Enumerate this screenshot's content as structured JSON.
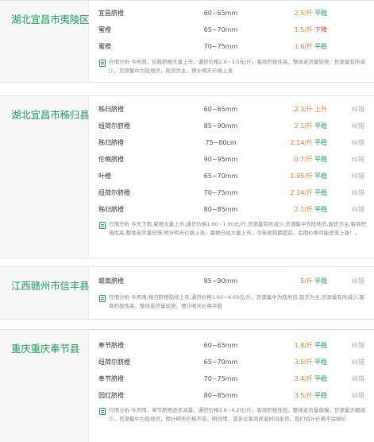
{
  "blocks": [
    {
      "region": "湖北宜昌市夷陵区",
      "rows": [
        {
          "name": "宜昌脐橙",
          "size": "60~65mm",
          "price": "2.5/斤",
          "trend": "平稳",
          "trend_type": "stable",
          "extra": ""
        },
        {
          "name": "蜜橙",
          "size": "65~70mm",
          "price": "1.5/斤",
          "trend": "下降",
          "trend_type": "down",
          "extra": ""
        },
        {
          "name": "蜜橙",
          "size": "70~75mm",
          "price": "1.6/斤",
          "trend": "平稳",
          "trend_type": "stable",
          "extra": ""
        }
      ],
      "note": "行情分析 今天阴，伦晚脐橙大量上市，通货价格2.8~3.5元/斤，客商积极性高，整体走货量较快，货源量有所减少，货源集中为陆地货，现货为主，预计明天价格上涨"
    },
    {
      "region": "湖北宜昌市秭归县",
      "rows": [
        {
          "name": "秭归脐橙",
          "size": "60~65mm",
          "price": "2.3/斤",
          "trend": "上升",
          "trend_type": "up",
          "extra": "纠错"
        },
        {
          "name": "纽荷尔脐橙",
          "size": "85~90mm",
          "price": "2.1/斤",
          "trend": "平稳",
          "trend_type": "stable",
          "extra": "纠错"
        },
        {
          "name": "秭归脐橙",
          "size": "75~80cm",
          "price": "2.14/斤",
          "trend": "平稳",
          "trend_type": "stable",
          "extra": "纠错"
        },
        {
          "name": "伦晚脐橙",
          "size": "90~95mm",
          "price": "0.7/斤",
          "trend": "平稳",
          "trend_type": "stable",
          "extra": "纠错"
        },
        {
          "name": "叶橙",
          "size": "65~70mm",
          "price": "1.95/斤",
          "trend": "平稳",
          "trend_type": "stable",
          "extra": "纠错"
        },
        {
          "name": "纽荷尔脐橙",
          "size": "70~75mm",
          "price": "2.24/斤",
          "trend": "平稳",
          "trend_type": "stable",
          "extra": "纠错"
        },
        {
          "name": "秭归脐橙",
          "size": "80~85mm",
          "price": "2.1/斤",
          "trend": "平稳",
          "trend_type": "stable",
          "extra": "纠错"
        }
      ],
      "note": "行情分析 今天下雨,夏橙大量上市,通货价格1.60~1.80元/斤,货源量有所减少,货源集中为陆地货,现货为主,客商积极性高,整体走货量较快,预计明天价格上涨。夏橙已经大量上市，今年收购期提前，后期价格可能逐渐上涨！。"
    },
    {
      "region": "江西赣州市信丰县",
      "rows": [
        {
          "name": "赣南脐橙",
          "size": "85~90mm",
          "price": "5/斤",
          "trend": "平稳",
          "trend_type": "stable",
          "extra": "纠错"
        }
      ],
      "note": "行情分析 今天晴,秭归脐橙陆续上市,通货价格1.60~4.60元/斤。货源集中为陆地货,现货为主,货源量有所减少,客商积极性高，整体走货量较快，预计明天价格平稳"
    },
    {
      "region": "重庆重庆奉节县",
      "rows": [
        {
          "name": "奉节脐橙",
          "size": "60~65mm",
          "price": "1.8/斤",
          "trend": "平稳",
          "trend_type": "stable",
          "extra": "纠错"
        },
        {
          "name": "纽荷尔脐橙",
          "size": "65~70mm",
          "price": "3.5/斤",
          "trend": "平稳",
          "trend_type": "stable",
          "extra": "纠错"
        },
        {
          "name": "奉节脐橙",
          "size": "70~75mm",
          "price": "3.4/斤",
          "trend": "平稳",
          "trend_type": "stable",
          "extra": "纠错"
        },
        {
          "name": "园红脐橙",
          "size": "80~85mm",
          "price": "3.5/斤",
          "trend": "平稳",
          "trend_type": "stable",
          "extra": "纠错"
        }
      ],
      "note": "行情分析 今天晴，奉节脐橙逐步减量，通货价格3.8~4.2元/斤，客商积极性低，整体走货量偏慢，货源量大概减少，货源集中为陆地货，预计明天价格不变。明日晴，望各位客商抓紧时间走货。我们估计价格不会掉价"
    }
  ]
}
